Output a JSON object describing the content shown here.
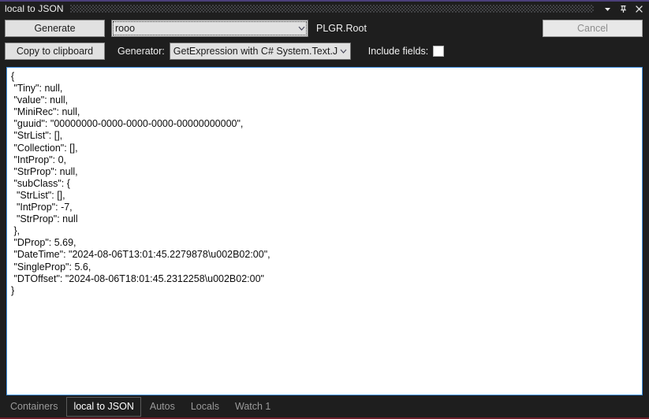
{
  "window": {
    "title": "local to JSON",
    "controls": [
      {
        "name": "window-dropdown-icon",
        "glyph": "chevron-down-icon"
      },
      {
        "name": "window-pin-icon",
        "glyph": "pin-icon"
      },
      {
        "name": "window-close-icon",
        "glyph": "close-icon"
      }
    ]
  },
  "toolbar": {
    "generate_label": "Generate",
    "copy_label": "Copy to clipboard",
    "cancel_label": "Cancel",
    "cancel_enabled": false,
    "root_combo_value": "rooo",
    "root_type_label": "PLGR.Root",
    "generator_label": "Generator:",
    "generator_combo_value": "GetExpression with C# System.Text.Json",
    "include_fields_label": "Include fields:",
    "include_fields_checked": false
  },
  "json_output": "{\n \"Tiny\": null,\n \"value\": null,\n \"MiniRec\": null,\n \"guuid\": \"00000000-0000-0000-0000-00000000000\",\n \"StrList\": [],\n \"Collection\": [],\n \"IntProp\": 0,\n \"StrProp\": null,\n \"subClass\": {\n  \"StrList\": [],\n  \"IntProp\": -7,\n  \"StrProp\": null\n },\n \"DProp\": 5.69,\n \"DateTime\": \"2024-08-06T13:01:45.2279878\\u002B02:00\",\n \"SingleProp\": 5.6,\n \"DTOffset\": \"2024-08-06T18:01:45.2312258\\u002B02:00\"\n}",
  "tabs": [
    {
      "label": "Containers",
      "active": false
    },
    {
      "label": "local to JSON",
      "active": true
    },
    {
      "label": "Autos",
      "active": false
    },
    {
      "label": "Locals",
      "active": false
    },
    {
      "label": "Watch 1",
      "active": false
    }
  ],
  "colors": {
    "window_background": "#1e1e1e",
    "top_accent": "#4b3f7a",
    "bottom_accent": "#6d1f2a",
    "text_primary": "#f0f0f0",
    "editor_background": "#ffffff",
    "editor_border_focus": "#3f8fe0",
    "button_face": "#e1e1e1",
    "tab_inactive_text": "#9a9a9a",
    "tab_active_text": "#ffffff"
  }
}
